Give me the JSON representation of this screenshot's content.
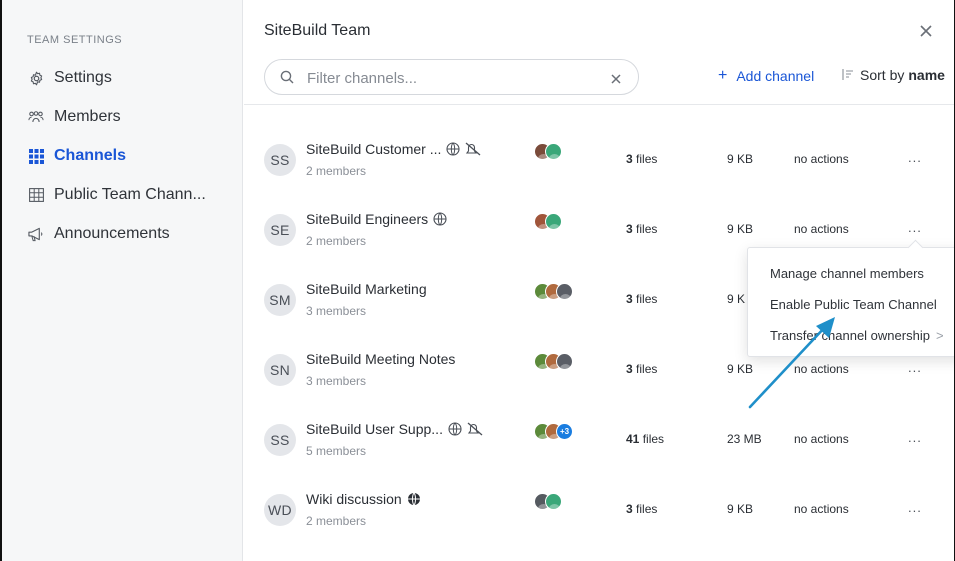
{
  "sidebar": {
    "heading": "TEAM SETTINGS",
    "items": [
      {
        "label": "Settings",
        "icon": "gear-icon"
      },
      {
        "label": "Members",
        "icon": "members-icon"
      },
      {
        "label": "Channels",
        "icon": "grid-icon"
      },
      {
        "label": "Public Team Chann...",
        "icon": "table-icon"
      },
      {
        "label": "Announcements",
        "icon": "megaphone-icon"
      }
    ],
    "active_color": "#1a56d6"
  },
  "header": {
    "title": "SiteBuild Team",
    "close": "×"
  },
  "filter": {
    "placeholder": "Filter channels...",
    "value": "",
    "clear": "×"
  },
  "toolbar": {
    "add_channel_plus": "+",
    "add_channel_label": "Add channel",
    "sort_prefix": "Sort by",
    "sort_field": "name"
  },
  "channels": [
    {
      "initials": "SS",
      "name": "SiteBuild Customer ...",
      "members": "2 members",
      "files_count": "3",
      "files_unit": "files",
      "size": "9 KB",
      "actions": "no actions",
      "globe": true,
      "muted": true,
      "faces": [
        "#7a4b3a",
        "#3aa779"
      ],
      "more": "..."
    },
    {
      "initials": "SE",
      "name": "SiteBuild Engineers",
      "members": "2 members",
      "files_count": "3",
      "files_unit": "files",
      "size": "9 KB",
      "actions": "no actions",
      "globe": true,
      "muted": false,
      "faces": [
        "#a0553a",
        "#3aa779"
      ],
      "more": "..."
    },
    {
      "initials": "SM",
      "name": "SiteBuild Marketing",
      "members": "3 members",
      "files_count": "3",
      "files_unit": "files",
      "size": "9 K",
      "actions": "",
      "globe": false,
      "muted": false,
      "faces": [
        "#5c8a3a",
        "#b06a3e",
        "#5a5e66"
      ],
      "more": ""
    },
    {
      "initials": "SN",
      "name": "SiteBuild Meeting Notes",
      "members": "3 members",
      "files_count": "3",
      "files_unit": "files",
      "size": "9 KB",
      "actions": "no actions",
      "globe": false,
      "muted": false,
      "faces": [
        "#5c8a3a",
        "#b06a3e",
        "#5a5e66"
      ],
      "more": "..."
    },
    {
      "initials": "SS",
      "name": "SiteBuild User Supp...",
      "members": "5 members",
      "files_count": "41",
      "files_unit": "files",
      "size": "23 MB",
      "actions": "no actions",
      "globe": true,
      "muted": true,
      "faces": [
        "#5c8a3a",
        "#b06a3e"
      ],
      "extra": "+3",
      "more": "..."
    },
    {
      "initials": "WD",
      "name": "Wiki discussion",
      "members": "2 members",
      "files_count": "3",
      "files_unit": "files",
      "size": "9 KB",
      "actions": "no actions",
      "globe": true,
      "globe_filled": true,
      "muted": false,
      "faces": [
        "#555a60",
        "#3aa779"
      ],
      "more": "..."
    }
  ],
  "dropdown": {
    "items": [
      {
        "label": "Manage channel members"
      },
      {
        "label": "Enable Public Team Channel"
      },
      {
        "label": "Transfer channel ownership",
        "chevron": ">"
      }
    ]
  },
  "annotation": {
    "arrow_color": "#1f8fc9"
  }
}
